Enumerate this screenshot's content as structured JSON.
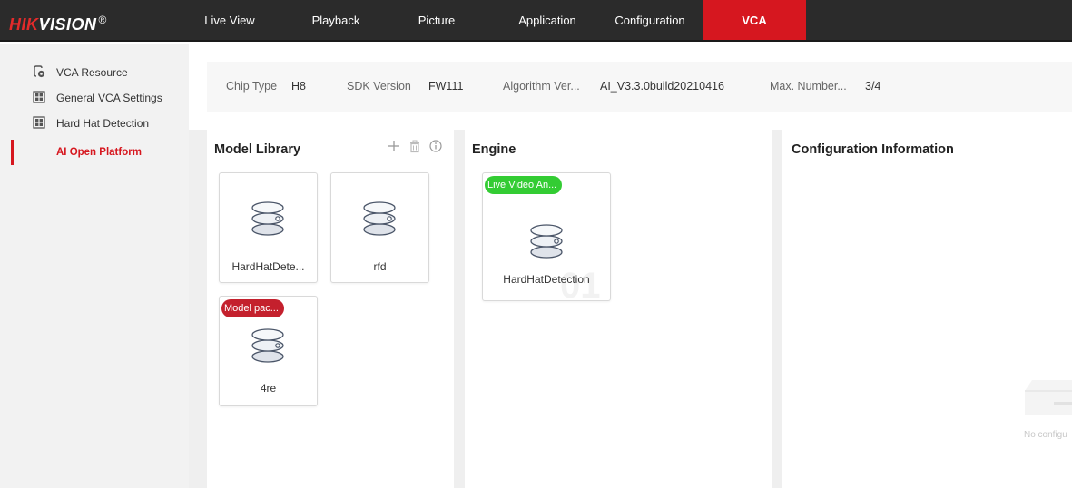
{
  "brand": {
    "logo_red": "HIK",
    "logo_white": "VISION",
    "registered": "®"
  },
  "nav": {
    "items": [
      {
        "label": "Live View"
      },
      {
        "label": "Playback"
      },
      {
        "label": "Picture"
      },
      {
        "label": "Application"
      },
      {
        "label": "Configuration"
      },
      {
        "label": "VCA",
        "active": true
      }
    ]
  },
  "sidebar": {
    "items": [
      {
        "label": "VCA Resource",
        "icon": "vca-resource-icon"
      },
      {
        "label": "General VCA Settings",
        "icon": "grid-icon"
      },
      {
        "label": "Hard Hat Detection",
        "icon": "grid-icon"
      },
      {
        "label": "AI Open Platform",
        "selected": true
      }
    ]
  },
  "info": {
    "chip_type_label": "Chip Type",
    "chip_type_value": "H8",
    "sdk_label": "SDK Version",
    "sdk_value": "FW111",
    "algo_label": "Algorithm Ver...",
    "algo_value": "AI_V3.3.0build20210416",
    "max_label": "Max. Number...",
    "max_value": "3/4"
  },
  "model_library": {
    "title": "Model Library",
    "tools": [
      "add-icon",
      "delete-icon",
      "info-icon"
    ],
    "cards": [
      {
        "name": "HardHatDete..."
      },
      {
        "name": "rfd"
      },
      {
        "name": "4re",
        "badge": "Model pac..."
      }
    ]
  },
  "engine": {
    "title": "Engine",
    "watermark": "01",
    "cards": [
      {
        "name": "HardHatDetection",
        "badge": "Live Video An..."
      }
    ]
  },
  "config_info": {
    "title": "Configuration Information",
    "empty_text": "No configu"
  },
  "colors": {
    "accent": "#d6171f",
    "topbar": "#2b2b2b",
    "badge_green": "#33cc33",
    "badge_red": "#c4202d"
  }
}
